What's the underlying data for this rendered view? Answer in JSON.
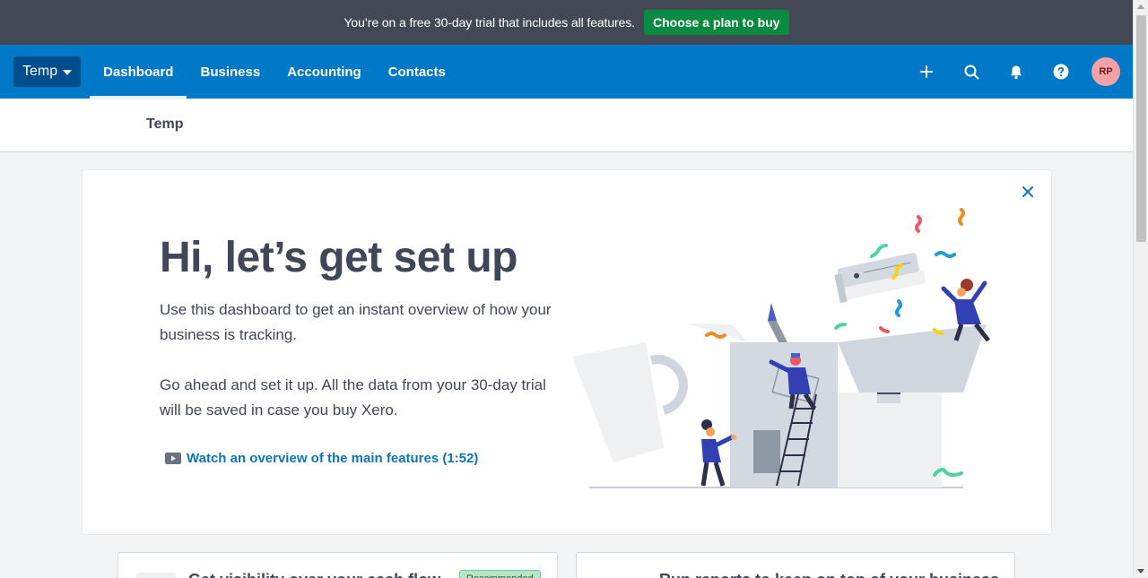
{
  "trial_banner": {
    "text": "You’re on a free 30-day trial that includes all features.",
    "button_label": "Choose a plan to buy"
  },
  "topnav": {
    "org_label": "Temp",
    "tabs": [
      {
        "label": "Dashboard",
        "active": true
      },
      {
        "label": "Business",
        "active": false
      },
      {
        "label": "Accounting",
        "active": false
      },
      {
        "label": "Contacts",
        "active": false
      }
    ],
    "icons": [
      "plus-icon",
      "search-icon",
      "bell-icon",
      "help-icon"
    ],
    "avatar_initials": "RP"
  },
  "subheader": {
    "title": "Temp"
  },
  "setup_card": {
    "headline": "Hi, let’s get set up",
    "paragraph1": "Use this dashboard to get an instant overview of how your business is tracking.",
    "paragraph2": "Go ahead and set it up. All the data from your 30-day trial will be saved in case you buy Xero.",
    "video_link": "Watch an overview of the main features (1:52)"
  },
  "bottom_cards": [
    {
      "title": "Get visibility over your cash flow",
      "badge": "Recommended"
    },
    {
      "title": "Run reports to keep on top of your business"
    }
  ],
  "colors": {
    "trial_bar": "#424854",
    "trial_button": "#0b8a42",
    "nav_blue": "#0078c8",
    "org_button": "#004f8c",
    "link_blue": "#0d74b9",
    "avatar": "#f4a1a5"
  }
}
